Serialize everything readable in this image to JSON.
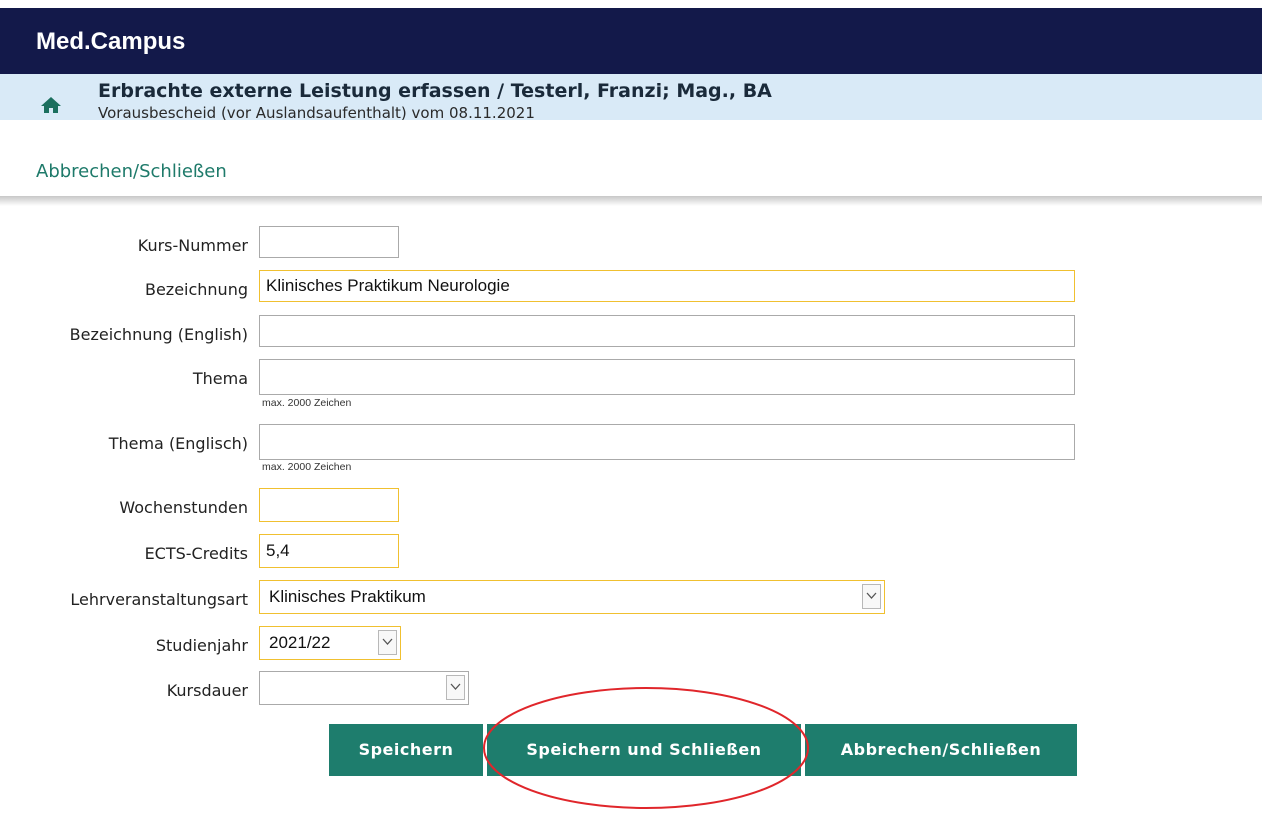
{
  "app": {
    "title": "Med.Campus"
  },
  "header": {
    "title": "Erbrachte externe Leistung erfassen  / Testerl, Franzi; Mag., BA",
    "subtitle": "Vorausbescheid (vor Auslandsaufenthalt) vom 08.11.2021",
    "home_icon": "home-icon"
  },
  "actions": {
    "cancel_close_link": "Abbrechen/Schließen"
  },
  "form": {
    "kurs_nummer": {
      "label": "Kurs-Nummer",
      "value": ""
    },
    "bezeichnung": {
      "label": "Bezeichnung",
      "value": "Klinisches Praktikum Neurologie"
    },
    "bezeichnung_en": {
      "label": "Bezeichnung (English)",
      "value": ""
    },
    "thema": {
      "label": "Thema",
      "value": "",
      "hint": "max. 2000 Zeichen"
    },
    "thema_en": {
      "label": "Thema (Englisch)",
      "value": "",
      "hint": "max. 2000 Zeichen"
    },
    "wochenstunden": {
      "label": "Wochenstunden",
      "value": ""
    },
    "ects": {
      "label": "ECTS-Credits",
      "value": "5,4"
    },
    "lv_art": {
      "label": "Lehrveranstaltungsart",
      "value": "Klinisches Praktikum"
    },
    "studienjahr": {
      "label": "Studienjahr",
      "value": "2021/22"
    },
    "kursdauer": {
      "label": "Kursdauer",
      "value": ""
    }
  },
  "buttons": {
    "save": "Speichern",
    "save_close": "Speichern und Schließen",
    "cancel_close": "Abbrechen/Schließen"
  },
  "colors": {
    "topbar": "#13194a",
    "subheader": "#d9eaf7",
    "accent": "#1e7d6d",
    "required_border": "#f0c030",
    "annotation": "#e0262b"
  }
}
